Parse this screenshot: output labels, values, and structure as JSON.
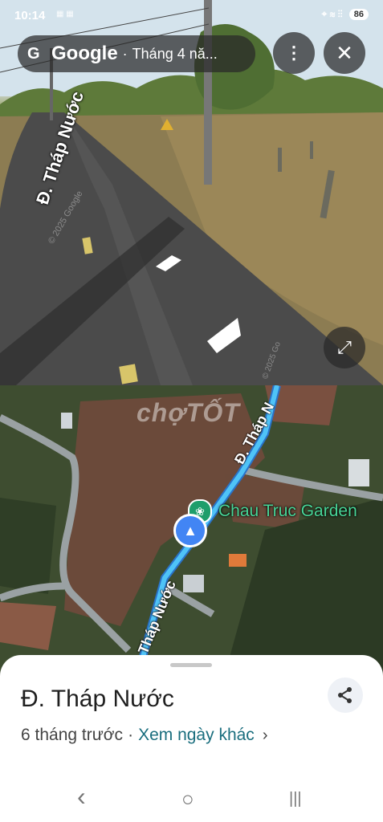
{
  "status_bar": {
    "time": "10:14",
    "icons_left": "▦ ▦",
    "icons_right": "⌖ ≋ ⫶⫶",
    "battery": "86"
  },
  "street_view": {
    "brand_letter": "G",
    "brand": "Google",
    "separator": "·",
    "date_text": "Tháng 4 nă...",
    "menu_label": "⋮",
    "close_label": "✕",
    "expand_label": "⤢",
    "road_label": "Đ. Tháp Nước",
    "copyright": "© 2025 Google",
    "copyright2": "© 2025 Go"
  },
  "map": {
    "watermark": "chợTỐT",
    "road_top": "Đ. Tháp N",
    "road_bottom": "Tháp Nước",
    "poi_label": "Chau Truc Garden",
    "poi_icon": "❀",
    "location_icon": "▲"
  },
  "sheet": {
    "title": "Đ. Tháp Nước",
    "relative_time": "6 tháng trước",
    "separator": "·",
    "other_dates_link": "Xem ngày khác",
    "chevron": "›"
  },
  "nav": {
    "back": "‹",
    "home": "○",
    "recents": "|||"
  },
  "colors": {
    "accent_teal": "#1a6e7e",
    "poi_green": "#48d597",
    "route_blue": "#4fc3f7",
    "location_blue": "#4285f4"
  }
}
